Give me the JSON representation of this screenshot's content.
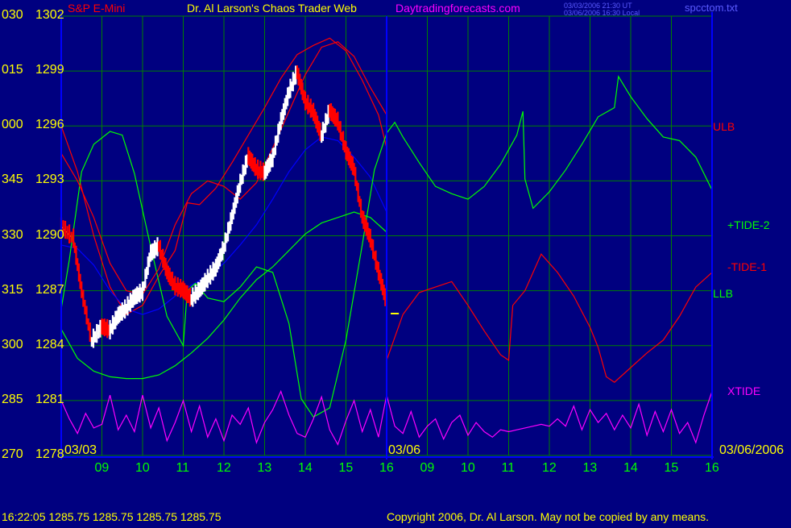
{
  "header": {
    "symbol": "S&P E-Mini",
    "title": "Dr. Al Larson's Chaos Trader Web",
    "site": "Daytradingforecasts.com",
    "stamp_ut": "03/03/2006 21:30 UT",
    "stamp_local": "03/06/2006 16:30 Local",
    "file": "spcctom.txt"
  },
  "footer": {
    "quote": "16:22:05  1285.75 1285.75 1285.75 1285.75",
    "copyright": "Copyright 2006, Dr. Al Larson. May not be copied by any means."
  },
  "colors": {
    "background": "#000080",
    "grid": "#008000",
    "axis": "#0000ff",
    "price_up": "#ffffff",
    "price_down": "#ff0000",
    "moving_avg": "#ffff00",
    "ulb": "#ff0000",
    "llb": "#00ff00",
    "tide_plus2": "#00ff00",
    "tide_minus1": "#ff0000",
    "xtide": "#ff00ff",
    "blue_avg": "#0000ff"
  },
  "chart_data": {
    "type": "line",
    "title": "S&P E-Mini",
    "y_axis": {
      "range": [
        1278,
        1302
      ],
      "ticks": [
        {
          "angle": "030",
          "price": "1302"
        },
        {
          "angle": "015",
          "price": "1299"
        },
        {
          "angle": "000",
          "price": "1296"
        },
        {
          "angle": "345",
          "price": "1293"
        },
        {
          "angle": "330",
          "price": "1290"
        },
        {
          "angle": "315",
          "price": "1287"
        },
        {
          "angle": "300",
          "price": "1284"
        },
        {
          "angle": "285",
          "price": "1281"
        },
        {
          "angle": "270",
          "price": "1278"
        }
      ]
    },
    "x_axis": {
      "range": [
        8,
        24
      ],
      "hour_ticks": [
        "09",
        "10",
        "11",
        "12",
        "13",
        "14",
        "15",
        "16",
        "09",
        "10",
        "11",
        "12",
        "13",
        "14",
        "15",
        "16"
      ],
      "date_labels": [
        "03/03",
        "03/06",
        "03/06/2006"
      ]
    },
    "line_labels": [
      "ULB",
      "+TIDE-2",
      "-TIDE-1",
      "LLB",
      "XTIDE"
    ],
    "last_bar": {
      "time": "16:22:05",
      "open": 1285.75,
      "high": 1285.75,
      "low": 1285.75,
      "close": 1285.75
    },
    "series": [
      {
        "name": "price",
        "values": [
          [
            8.0,
            1290.5
          ],
          [
            8.3,
            1289.8
          ],
          [
            8.5,
            1287.0
          ],
          [
            8.75,
            1284.2
          ],
          [
            9.0,
            1285.0
          ],
          [
            9.2,
            1284.8
          ],
          [
            9.4,
            1285.6
          ],
          [
            9.6,
            1286.0
          ],
          [
            9.8,
            1286.6
          ],
          [
            10.0,
            1286.9
          ],
          [
            10.2,
            1289.0
          ],
          [
            10.4,
            1289.4
          ],
          [
            10.6,
            1288.0
          ],
          [
            10.8,
            1287.2
          ],
          [
            11.0,
            1287.0
          ],
          [
            11.2,
            1286.5
          ],
          [
            11.4,
            1287.0
          ],
          [
            11.6,
            1287.6
          ],
          [
            11.8,
            1288.2
          ],
          [
            12.0,
            1289.3
          ],
          [
            12.2,
            1291.0
          ],
          [
            12.4,
            1292.8
          ],
          [
            12.6,
            1294.3
          ],
          [
            12.8,
            1293.6
          ],
          [
            13.0,
            1293.4
          ],
          [
            13.2,
            1294.2
          ],
          [
            13.4,
            1296.2
          ],
          [
            13.6,
            1297.8
          ],
          [
            13.8,
            1298.9
          ],
          [
            14.0,
            1297.3
          ],
          [
            14.2,
            1296.7
          ],
          [
            14.4,
            1295.4
          ],
          [
            14.6,
            1296.8
          ],
          [
            14.8,
            1296.2
          ],
          [
            15.0,
            1294.6
          ],
          [
            15.2,
            1293.6
          ],
          [
            15.4,
            1291.0
          ],
          [
            15.6,
            1289.8
          ],
          [
            15.8,
            1288.0
          ],
          [
            16.0,
            1286.3
          ]
        ]
      },
      {
        "name": "ULB",
        "values": [
          [
            8.0,
            1296
          ],
          [
            8.4,
            1293.5
          ],
          [
            8.8,
            1290.0
          ],
          [
            9.2,
            1287.2
          ],
          [
            9.6,
            1285.7
          ],
          [
            10.0,
            1286.2
          ],
          [
            10.4,
            1287.8
          ],
          [
            10.8,
            1289.2
          ],
          [
            11.1,
            1291.8
          ],
          [
            11.4,
            1291.7
          ],
          [
            11.8,
            1292.6
          ],
          [
            12.2,
            1294.0
          ],
          [
            12.6,
            1295.5
          ],
          [
            13.0,
            1297.0
          ],
          [
            13.4,
            1298.6
          ],
          [
            13.8,
            1299.9
          ],
          [
            14.2,
            1300.4
          ],
          [
            14.6,
            1300.8
          ],
          [
            15.0,
            1300.1
          ],
          [
            15.4,
            1298.5
          ],
          [
            15.8,
            1296.6
          ],
          [
            16.0,
            1294.8
          ]
        ]
      },
      {
        "name": "LLB",
        "values": [
          [
            8.0,
            1284.9
          ],
          [
            8.4,
            1283.3
          ],
          [
            8.8,
            1282.6
          ],
          [
            9.2,
            1282.3
          ],
          [
            9.6,
            1282.2
          ],
          [
            10.0,
            1282.2
          ],
          [
            10.4,
            1282.4
          ],
          [
            10.8,
            1282.9
          ],
          [
            11.2,
            1283.6
          ],
          [
            11.6,
            1284.4
          ],
          [
            12.0,
            1285.4
          ],
          [
            12.4,
            1286.6
          ],
          [
            12.8,
            1287.6
          ],
          [
            13.2,
            1288.3
          ],
          [
            13.6,
            1289.2
          ],
          [
            14.0,
            1290.1
          ],
          [
            14.4,
            1290.7
          ],
          [
            14.8,
            1291.0
          ],
          [
            15.2,
            1291.3
          ],
          [
            15.6,
            1291.0
          ],
          [
            16.0,
            1290.2
          ]
        ]
      },
      {
        "name": "blue_avg",
        "values": [
          [
            8.0,
            1289.5
          ],
          [
            8.4,
            1289.3
          ],
          [
            8.8,
            1288.4
          ],
          [
            9.2,
            1287.0
          ],
          [
            9.6,
            1286.0
          ],
          [
            10.0,
            1285.7
          ],
          [
            10.4,
            1286.0
          ],
          [
            10.8,
            1286.7
          ],
          [
            11.2,
            1287.3
          ],
          [
            11.6,
            1287.8
          ],
          [
            12.0,
            1288.5
          ],
          [
            12.4,
            1289.5
          ],
          [
            12.8,
            1290.6
          ],
          [
            13.2,
            1292.0
          ],
          [
            13.6,
            1293.5
          ],
          [
            14.0,
            1294.7
          ],
          [
            14.4,
            1295.4
          ],
          [
            14.8,
            1295.2
          ],
          [
            15.2,
            1294.3
          ],
          [
            15.6,
            1293.2
          ],
          [
            16.0,
            1291.3
          ]
        ]
      },
      {
        "name": "+TIDE-2",
        "values": [
          [
            8.0,
            1286.0
          ],
          [
            8.2,
            1288.7
          ],
          [
            8.5,
            1293.5
          ],
          [
            8.8,
            1295.0
          ],
          [
            9.2,
            1295.7
          ],
          [
            9.5,
            1295.5
          ],
          [
            9.8,
            1293.4
          ],
          [
            10.2,
            1289.4
          ],
          [
            10.6,
            1285.6
          ],
          [
            11.0,
            1284.0
          ],
          [
            11.1,
            1287.0
          ],
          [
            11.3,
            1287.4
          ],
          [
            11.6,
            1286.6
          ],
          [
            12.0,
            1286.4
          ],
          [
            12.4,
            1287.2
          ],
          [
            12.8,
            1288.3
          ],
          [
            13.2,
            1288.0
          ],
          [
            13.6,
            1285.2
          ],
          [
            13.9,
            1281.1
          ],
          [
            14.2,
            1280.1
          ],
          [
            14.6,
            1280.6
          ],
          [
            15.0,
            1284.3
          ],
          [
            15.4,
            1289.5
          ],
          [
            15.7,
            1293.6
          ],
          [
            16.0,
            1295.6
          ],
          [
            16.2,
            1296.2
          ],
          [
            16.4,
            1295.4
          ],
          [
            16.8,
            1294.0
          ],
          [
            17.2,
            1292.7
          ],
          [
            17.6,
            1292.3
          ],
          [
            18.0,
            1292.0
          ],
          [
            18.4,
            1292.7
          ],
          [
            18.8,
            1293.9
          ],
          [
            19.2,
            1295.5
          ],
          [
            19.35,
            1296.8
          ],
          [
            19.4,
            1293.1
          ],
          [
            19.6,
            1291.5
          ],
          [
            20.0,
            1292.4
          ],
          [
            20.4,
            1293.6
          ],
          [
            20.8,
            1295.0
          ],
          [
            21.2,
            1296.5
          ],
          [
            21.6,
            1297.0
          ],
          [
            21.7,
            1298.7
          ],
          [
            22.0,
            1297.6
          ],
          [
            22.4,
            1296.4
          ],
          [
            22.8,
            1295.4
          ],
          [
            23.2,
            1295.2
          ],
          [
            23.6,
            1294.3
          ],
          [
            24.0,
            1292.5
          ]
        ]
      },
      {
        "name": "-TIDE-1",
        "values": [
          [
            8.0,
            1294.5
          ],
          [
            8.4,
            1293.0
          ],
          [
            8.8,
            1291.0
          ],
          [
            9.2,
            1288.5
          ],
          [
            9.6,
            1287.0
          ],
          [
            10.0,
            1286.8
          ],
          [
            10.4,
            1288.2
          ],
          [
            10.8,
            1290.6
          ],
          [
            11.2,
            1292.3
          ],
          [
            11.6,
            1293.0
          ],
          [
            12.0,
            1292.7
          ],
          [
            12.4,
            1292.0
          ],
          [
            12.8,
            1292.9
          ],
          [
            13.2,
            1294.8
          ],
          [
            13.6,
            1296.8
          ],
          [
            14.0,
            1298.8
          ],
          [
            14.4,
            1300.3
          ],
          [
            14.8,
            1300.6
          ],
          [
            15.2,
            1299.8
          ],
          [
            15.6,
            1298.1
          ],
          [
            16.0,
            1296.6
          ],
          [
            16.0,
            1283.2
          ],
          [
            16.4,
            1285.7
          ],
          [
            16.8,
            1286.9
          ],
          [
            17.2,
            1287.2
          ],
          [
            17.6,
            1287.5
          ],
          [
            18.0,
            1286.2
          ],
          [
            18.4,
            1284.8
          ],
          [
            18.8,
            1283.5
          ],
          [
            19.0,
            1283.2
          ],
          [
            19.1,
            1286.2
          ],
          [
            19.4,
            1287.0
          ],
          [
            19.8,
            1289.0
          ],
          [
            20.2,
            1288.0
          ],
          [
            20.6,
            1286.7
          ],
          [
            21.0,
            1285.0
          ],
          [
            21.2,
            1283.9
          ],
          [
            21.4,
            1282.3
          ],
          [
            21.6,
            1282.0
          ],
          [
            22.0,
            1282.8
          ],
          [
            22.4,
            1283.6
          ],
          [
            22.8,
            1284.3
          ],
          [
            23.2,
            1285.6
          ],
          [
            23.6,
            1287.2
          ],
          [
            24.0,
            1288.0
          ]
        ]
      },
      {
        "name": "XTIDE",
        "values": [
          [
            8.0,
            1281.0
          ],
          [
            8.2,
            1280.0
          ],
          [
            8.4,
            1279.2
          ],
          [
            8.6,
            1280.3
          ],
          [
            8.8,
            1279.5
          ],
          [
            9.0,
            1279.7
          ],
          [
            9.2,
            1281.3
          ],
          [
            9.4,
            1279.4
          ],
          [
            9.6,
            1280.2
          ],
          [
            9.8,
            1279.3
          ],
          [
            10.0,
            1281.3
          ],
          [
            10.2,
            1279.5
          ],
          [
            10.4,
            1280.6
          ],
          [
            10.6,
            1278.8
          ],
          [
            10.8,
            1279.8
          ],
          [
            11.0,
            1281.0
          ],
          [
            11.2,
            1279.3
          ],
          [
            11.4,
            1280.7
          ],
          [
            11.6,
            1279.0
          ],
          [
            11.8,
            1280.0
          ],
          [
            12.0,
            1278.8
          ],
          [
            12.2,
            1280.2
          ],
          [
            12.4,
            1279.7
          ],
          [
            12.6,
            1280.6
          ],
          [
            12.8,
            1278.7
          ],
          [
            13.0,
            1279.8
          ],
          [
            13.2,
            1280.5
          ],
          [
            13.4,
            1281.5
          ],
          [
            13.6,
            1280.2
          ],
          [
            13.8,
            1279.2
          ],
          [
            14.0,
            1279.0
          ],
          [
            14.2,
            1280.0
          ],
          [
            14.4,
            1281.2
          ],
          [
            14.6,
            1279.4
          ],
          [
            14.8,
            1278.6
          ],
          [
            15.0,
            1279.9
          ],
          [
            15.2,
            1281.0
          ],
          [
            15.4,
            1279.3
          ],
          [
            15.6,
            1280.5
          ],
          [
            15.8,
            1279.0
          ],
          [
            16.0,
            1281.3
          ],
          [
            16.2,
            1279.6
          ],
          [
            16.4,
            1279.2
          ],
          [
            16.6,
            1280.4
          ],
          [
            16.8,
            1279.0
          ],
          [
            17.0,
            1279.6
          ],
          [
            17.2,
            1280.0
          ],
          [
            17.4,
            1278.9
          ],
          [
            17.6,
            1279.8
          ],
          [
            17.8,
            1280.2
          ],
          [
            18.0,
            1279.1
          ],
          [
            18.2,
            1279.8
          ],
          [
            18.4,
            1279.3
          ],
          [
            18.6,
            1279.0
          ],
          [
            18.8,
            1279.4
          ],
          [
            19.0,
            1279.3
          ],
          [
            19.2,
            1279.4
          ],
          [
            19.4,
            1279.5
          ],
          [
            19.6,
            1279.6
          ],
          [
            19.8,
            1279.7
          ],
          [
            20.0,
            1279.6
          ],
          [
            20.2,
            1280.0
          ],
          [
            20.4,
            1279.6
          ],
          [
            20.6,
            1280.7
          ],
          [
            20.8,
            1279.4
          ],
          [
            21.0,
            1280.5
          ],
          [
            21.2,
            1279.8
          ],
          [
            21.4,
            1280.3
          ],
          [
            21.6,
            1279.4
          ],
          [
            21.8,
            1280.2
          ],
          [
            22.0,
            1279.5
          ],
          [
            22.2,
            1280.8
          ],
          [
            22.4,
            1279.1
          ],
          [
            22.6,
            1280.4
          ],
          [
            22.8,
            1279.3
          ],
          [
            23.0,
            1280.5
          ],
          [
            23.2,
            1279.2
          ],
          [
            23.4,
            1279.8
          ],
          [
            23.6,
            1278.7
          ],
          [
            23.8,
            1280.2
          ],
          [
            24.0,
            1281.5
          ]
        ]
      }
    ]
  }
}
